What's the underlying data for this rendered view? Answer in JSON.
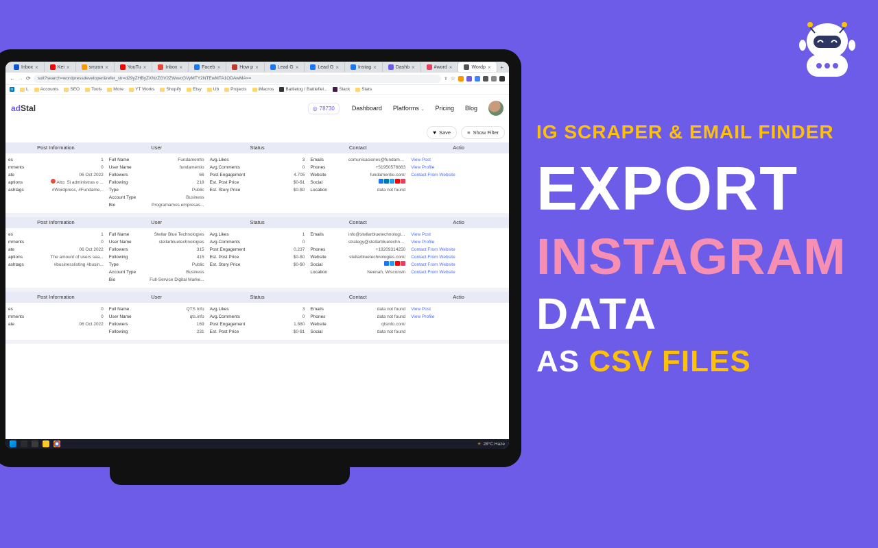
{
  "promo": {
    "line1": "IG SCRAPER & EMAIL FINDER",
    "line2": "EXPORT",
    "line3": "INSTAGRAM",
    "line4": "DATA",
    "line5a": "AS ",
    "line5b": "CSV FILES"
  },
  "browser": {
    "tabs": [
      {
        "label": "Inbox",
        "color": "#0b57d0"
      },
      {
        "label": "Kei",
        "color": "#ff0000"
      },
      {
        "label": "smzon",
        "color": "#ff9900"
      },
      {
        "label": "YouTu",
        "color": "#ff0000"
      },
      {
        "label": "Inbox",
        "color": "#ea4335"
      },
      {
        "label": "Faceb",
        "color": "#1877f2"
      },
      {
        "label": "How p",
        "color": "#c0392b"
      },
      {
        "label": "Lead G",
        "color": "#1877f2"
      },
      {
        "label": "Lead G",
        "color": "#1877f2"
      },
      {
        "label": "Instag",
        "color": "#1877f2"
      },
      {
        "label": "Dashb",
        "color": "#6c5ce7"
      },
      {
        "label": "#word",
        "color": "#e4405f"
      },
      {
        "label": "Wordp",
        "color": "#555",
        "active": true
      }
    ],
    "url": "sult?search=wordpressdeveloper&refer_str=d29yZHByZXNzZGV2ZWxvcGVyMTY2NTEwMTA1ODAwMA==",
    "bookmarks": [
      "L",
      "Accounts",
      "SEO",
      "Tools",
      "More",
      "YT Works",
      "Shopify",
      "Etsy",
      "Ub",
      "Projects",
      "iMacros",
      "Battlelog / Battlefiel...",
      "Slack",
      "Stats"
    ]
  },
  "app": {
    "logo_a": "ad",
    "logo_b": "Stal",
    "credits": "78730",
    "nav": {
      "dashboard": "Dashboard",
      "platforms": "Platforms",
      "pricing": "Pricing",
      "blog": "Blog"
    },
    "save": "Save",
    "show_filter": "Show Filter"
  },
  "columns": [
    "Post Information",
    "User",
    "Status",
    "Contact",
    "Actio"
  ],
  "rows": [
    {
      "post": [
        {
          "k": "es",
          "v": "1"
        },
        {
          "k": "mments",
          "v": "0"
        },
        {
          "k": "ate",
          "v": "06 Oct 2022"
        },
        {
          "k": "aptions",
          "v": "Alto: Si administras o ...",
          "warn": true
        },
        {
          "k": "ashtags",
          "v": "#Wordpress, #Fundame..."
        }
      ],
      "user": [
        {
          "k": "Full Name",
          "v": "FundamentIo"
        },
        {
          "k": "User Name",
          "v": "fundamentio"
        },
        {
          "k": "Followers",
          "v": "66"
        },
        {
          "k": "Following",
          "v": "218"
        },
        {
          "k": "Type",
          "v": "Public"
        },
        {
          "k": "Account Type",
          "v": "Business"
        },
        {
          "k": "Bio",
          "v": "Programamos empresas..."
        }
      ],
      "status": [
        {
          "k": "Avg.Likes",
          "v": "3"
        },
        {
          "k": "Avg.Comments",
          "v": "0"
        },
        {
          "k": "Post Engagement",
          "v": "4.705"
        },
        {
          "k": "Est. Post Price",
          "v": "$0-$1"
        },
        {
          "k": "Est. Story Price",
          "v": "$0-$0"
        }
      ],
      "contact": [
        {
          "k": "Emails",
          "v": "comunicaciones@fundamen..."
        },
        {
          "k": "Phones",
          "v": "+51950576883"
        },
        {
          "k": "Website",
          "v": "fundamentio.com/"
        },
        {
          "k": "Social",
          "social": [
            "#1877f2",
            "#0077b5",
            "#1da1f2",
            "#ff0000",
            "#e4405f"
          ]
        },
        {
          "k": "Location",
          "v": "data not found"
        }
      ],
      "actions": [
        "View Post",
        "View Profile",
        "Contact From Website"
      ]
    },
    {
      "post": [
        {
          "k": "es",
          "v": "1"
        },
        {
          "k": "mments",
          "v": "0"
        },
        {
          "k": "ate",
          "v": "06 Oct 2022"
        },
        {
          "k": "aptions",
          "v": "The amount of users sea..."
        },
        {
          "k": "ashtags",
          "v": "#businesslisting #busin..."
        }
      ],
      "user": [
        {
          "k": "Full Name",
          "v": "Stellar Blue Technologies"
        },
        {
          "k": "User Name",
          "v": "stellarbluetechnologies"
        },
        {
          "k": "Followers",
          "v": "315"
        },
        {
          "k": "Following",
          "v": "415"
        },
        {
          "k": "Type",
          "v": "Public"
        },
        {
          "k": "Account Type",
          "v": "Business"
        },
        {
          "k": "Bio",
          "v": "Full-Service Digital Marke..."
        }
      ],
      "status": [
        {
          "k": "Avg.Likes",
          "v": "1"
        },
        {
          "k": "Avg.Comments",
          "v": "0"
        },
        {
          "k": "Post Engagement",
          "v": "0.237"
        },
        {
          "k": "Est. Post Price",
          "v": "$0-$0"
        },
        {
          "k": "Est. Story Price",
          "v": "$0-$0"
        }
      ],
      "contact": [
        {
          "k": "Emails",
          "v": "info@stellarbluetechnologies..."
        },
        {
          "k": "",
          "v": "strategy@stellarbluetechnol..."
        },
        {
          "k": "Phones",
          "v": "+19209314250"
        },
        {
          "k": "Website",
          "v": "stellarbluetechnologies.com/"
        },
        {
          "k": "Social",
          "social": [
            "#1877f2",
            "#1da1f2",
            "#ff0000",
            "#e4405f"
          ]
        },
        {
          "k": "Location",
          "v": "Neenah, Wisconsin"
        }
      ],
      "actions": [
        "View Post",
        "View Profile",
        "Contact From Website",
        "Contact From Website",
        "Contact From Website",
        "Contact From Website"
      ]
    },
    {
      "post": [
        {
          "k": "es",
          "v": "0"
        },
        {
          "k": "mments",
          "v": "0"
        },
        {
          "k": "ate",
          "v": "06 Oct 2022"
        }
      ],
      "user": [
        {
          "k": "Full Name",
          "v": "QTS Info"
        },
        {
          "k": "User Name",
          "v": "qts.info"
        },
        {
          "k": "Followers",
          "v": "169"
        },
        {
          "k": "Following",
          "v": "231"
        }
      ],
      "status": [
        {
          "k": "Avg.Likes",
          "v": "3"
        },
        {
          "k": "Avg.Comments",
          "v": "0"
        },
        {
          "k": "Post Engagement",
          "v": "1.880"
        },
        {
          "k": "Est. Post Price",
          "v": "$0-$1"
        }
      ],
      "contact": [
        {
          "k": "Emails",
          "v": "data not found"
        },
        {
          "k": "Phones",
          "v": "data not found"
        },
        {
          "k": "Website",
          "v": "qtsinfo.com/"
        },
        {
          "k": "Social",
          "v": "data not found"
        }
      ],
      "actions": [
        "View Post",
        "View Profile"
      ]
    }
  ],
  "taskbar": {
    "weather": "28°C Haze"
  }
}
